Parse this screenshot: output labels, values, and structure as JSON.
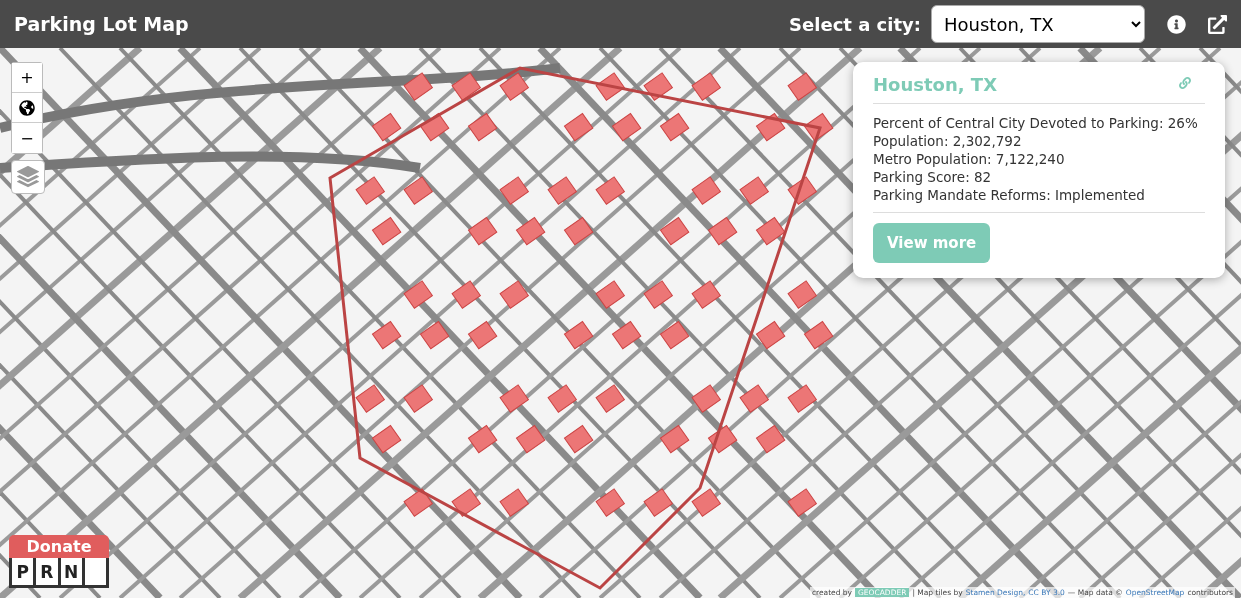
{
  "header": {
    "title": "Parking Lot Map",
    "city_label": "Select a city:",
    "city_value": "Houston, TX"
  },
  "map_controls": {
    "zoom_in": "+",
    "zoom_out": "−"
  },
  "popup": {
    "title": "Houston, TX",
    "stats": [
      "Percent of Central City Devoted to Parking: 26%",
      "Population: 2,302,792",
      "Metro Population: 7,122,240",
      "Parking Score: 82",
      "Parking Mandate Reforms: Implemented"
    ],
    "button": "View more"
  },
  "donate": {
    "label": "Donate",
    "letters": [
      "P",
      "R",
      "N"
    ]
  },
  "attribution": {
    "created_by": "created by",
    "badge": "GEOCADDER",
    "tiles_prefix": "| Map tiles by",
    "tiles_link": "Stamen Design,",
    "license_link": "CC BY 3.0",
    "data_prefix": "— Map data ©",
    "data_link": "OpenStreetMap",
    "suffix": "contributors"
  }
}
